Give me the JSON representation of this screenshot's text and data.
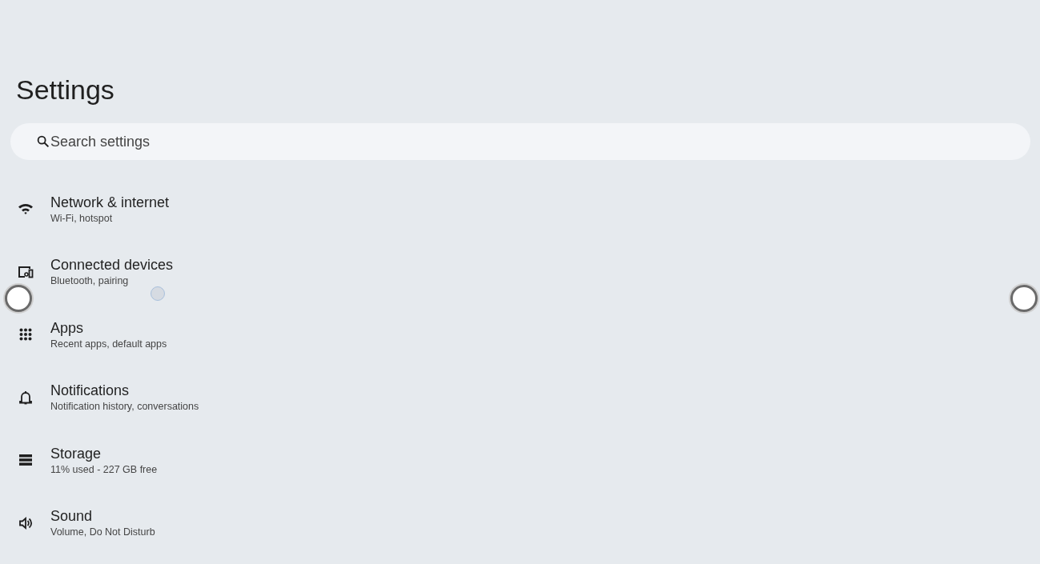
{
  "title": "Settings",
  "search": {
    "placeholder": "Search settings"
  },
  "items": [
    {
      "title": "Network & internet",
      "subtitle": "Wi-Fi, hotspot"
    },
    {
      "title": "Connected devices",
      "subtitle": "Bluetooth, pairing"
    },
    {
      "title": "Apps",
      "subtitle": "Recent apps, default apps"
    },
    {
      "title": "Notifications",
      "subtitle": "Notification history, conversations"
    },
    {
      "title": "Storage",
      "subtitle": "11% used - 227 GB free"
    },
    {
      "title": "Sound",
      "subtitle": "Volume, Do Not Disturb"
    }
  ]
}
